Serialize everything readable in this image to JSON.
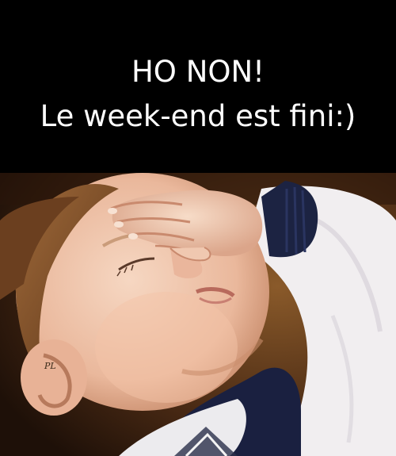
{
  "caption": {
    "line1": "HO NON!",
    "line2": "Le week-end est fini:)"
  },
  "photo": {
    "subject": "child-facepalm",
    "watermark": "PL"
  }
}
